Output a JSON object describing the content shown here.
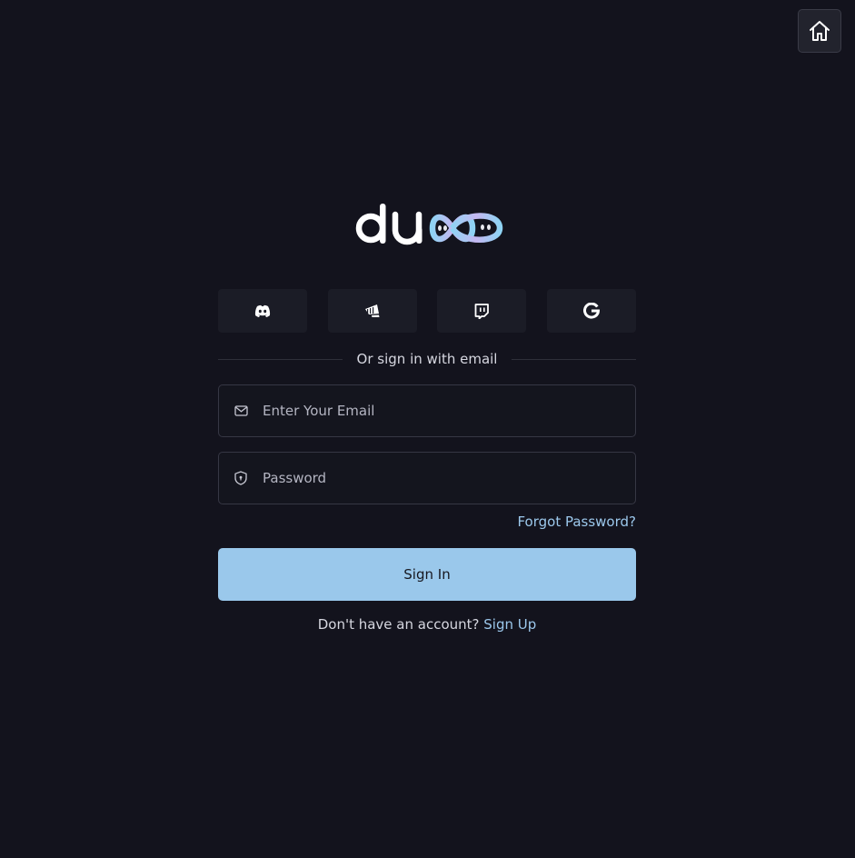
{
  "brand": {
    "logo_text": "du∞",
    "gradient_colors": [
      "#8fd3f4",
      "#c5b7f1",
      "#f4c6e7"
    ]
  },
  "header": {
    "home_icon": "home-icon"
  },
  "social_login": [
    {
      "provider": "discord",
      "icon": "discord-icon"
    },
    {
      "provider": "riot",
      "icon": "riot-icon"
    },
    {
      "provider": "twitch",
      "icon": "twitch-icon"
    },
    {
      "provider": "google",
      "icon": "google-icon"
    }
  ],
  "divider_text": "Or sign in with email",
  "form": {
    "email": {
      "placeholder": "Enter Your Email",
      "value": "",
      "icon": "mail-icon"
    },
    "password": {
      "placeholder": "Password",
      "value": "",
      "icon": "shield-icon"
    },
    "forgot_label": "Forgot Password?",
    "submit_label": "Sign In"
  },
  "signup": {
    "prompt": "Don't have an account?",
    "link_label": "Sign Up"
  },
  "colors": {
    "background": "#13131d",
    "accent": "#9ac8eb",
    "link": "#9cc8ec",
    "surface": "#1b1c26"
  }
}
